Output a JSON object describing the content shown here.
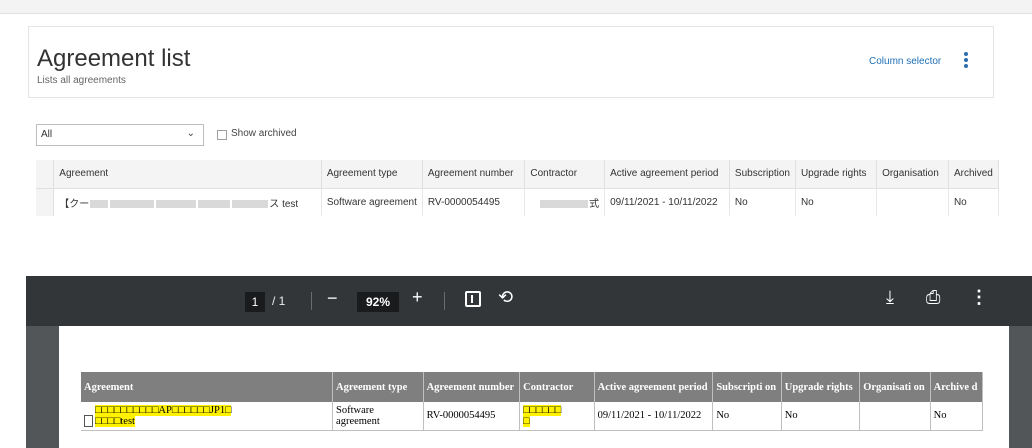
{
  "agreement_list": {
    "title": "Agreement list",
    "subtitle": "Lists all agreements",
    "column_selector_label": "Column selector",
    "filter": {
      "selected": "All"
    },
    "show_archived_label": "Show archived",
    "columns": [
      "Agreement",
      "Agreement type",
      "Agreement number",
      "Contractor",
      "Active agreement period",
      "Subscription",
      "Upgrade rights",
      "Organisation",
      "Archived"
    ],
    "rows": [
      {
        "agreement_prefix": "【クー",
        "agreement_suffix": "ス test",
        "agreement_type": "Software agreement",
        "agreement_number": "RV-0000054495",
        "contractor_suffix": "式",
        "period": "09/11/2021 - 10/11/2022",
        "subscription": "No",
        "upgrade_rights": "No",
        "organisation": "",
        "archived": "No"
      }
    ]
  },
  "pdf_viewer": {
    "page_current": "1",
    "page_total": "/ 1",
    "zoom": "92%",
    "columns": [
      "Agreement",
      "Agreement type",
      "Agreement number",
      "Contractor",
      "Active agreement period",
      "Subscripti on",
      "Upgrade rights",
      "Organisati on",
      "Archive d"
    ],
    "row": {
      "agreement_line1": "□□□□□□□□□□AP□□□□□□JP1□",
      "agreement_line2": "□□□□test",
      "agreement_type": "Software agreement",
      "agreement_number": "RV-0000054495",
      "contractor_line1": "□□□□□□",
      "contractor_line2": "□",
      "period": "09/11/2021 - 10/11/2022",
      "subscription": "No",
      "upgrade_rights": "No",
      "organisation": "",
      "archived": "No"
    },
    "icons": {
      "minus": "−",
      "plus": "+",
      "rotate": "⟲",
      "download": "⤓",
      "print": "⎙",
      "more": "⋮"
    },
    "highlight_color": "#fff200"
  }
}
